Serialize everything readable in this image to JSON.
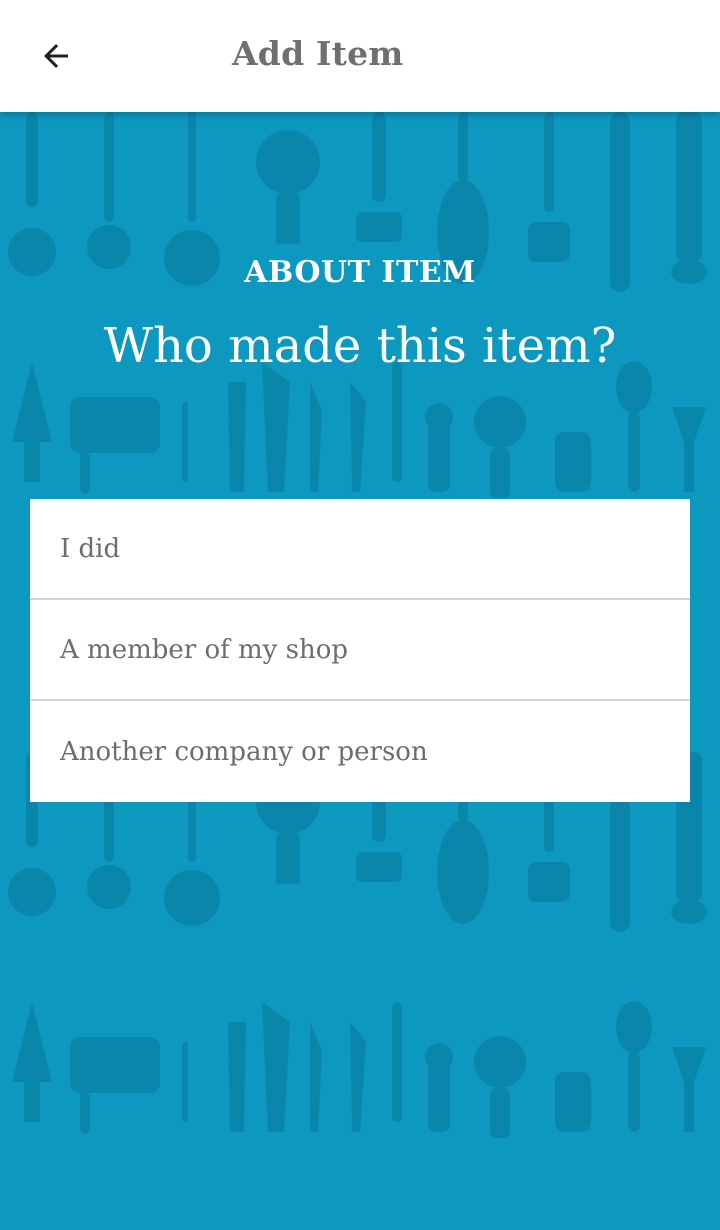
{
  "appbar": {
    "title": "Add Item",
    "back_icon": "arrow-left-icon"
  },
  "content": {
    "section_label": "ABOUT ITEM",
    "question": "Who made this item?"
  },
  "options": [
    {
      "label": "I did"
    },
    {
      "label": "A member of my shop"
    },
    {
      "label": "Another company or person"
    }
  ],
  "colors": {
    "background": "#0c98bf",
    "pattern": "#0a86aa",
    "appbar": "#ffffff",
    "title_text": "#6f6f6f",
    "option_text": "#6d6d6d"
  }
}
